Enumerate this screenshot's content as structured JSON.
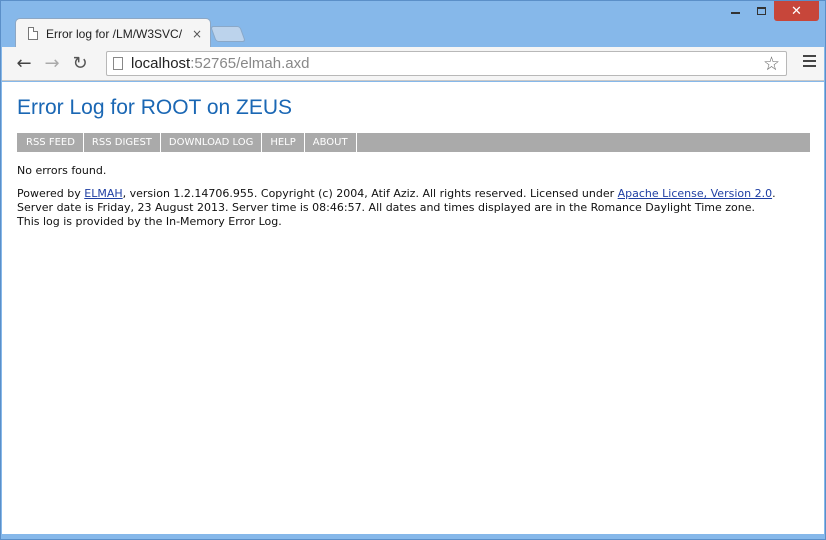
{
  "browser": {
    "tab_title": "Error log for /LM/W3SVC/",
    "url_host": "localhost",
    "url_rest": ":52765/elmah.axd"
  },
  "page": {
    "title": "Error Log for ROOT on ZEUS",
    "speedbar": [
      "RSS FEED",
      "RSS DIGEST",
      "DOWNLOAD LOG",
      "HELP",
      "ABOUT"
    ],
    "message": "No errors found.",
    "footer": {
      "powered_prefix": "Powered by ",
      "elmah_link": "ELMAH",
      "version_text": ", version 1.2.14706.955. Copyright (c) 2004, Atif Aziz. All rights reserved. Licensed under ",
      "license_link": "Apache License, Version 2.0",
      "after_license": ".",
      "server_line": "Server date is Friday, 23 August 2013. Server time is 08:46:57. All dates and times displayed are in the Romance Daylight Time zone.",
      "log_line": "This log is provided by the In-Memory Error Log."
    }
  },
  "icons": {
    "tab_close": "×",
    "back": "←",
    "forward": "→",
    "reload": "↻",
    "star": "☆",
    "close_window": "✕"
  }
}
